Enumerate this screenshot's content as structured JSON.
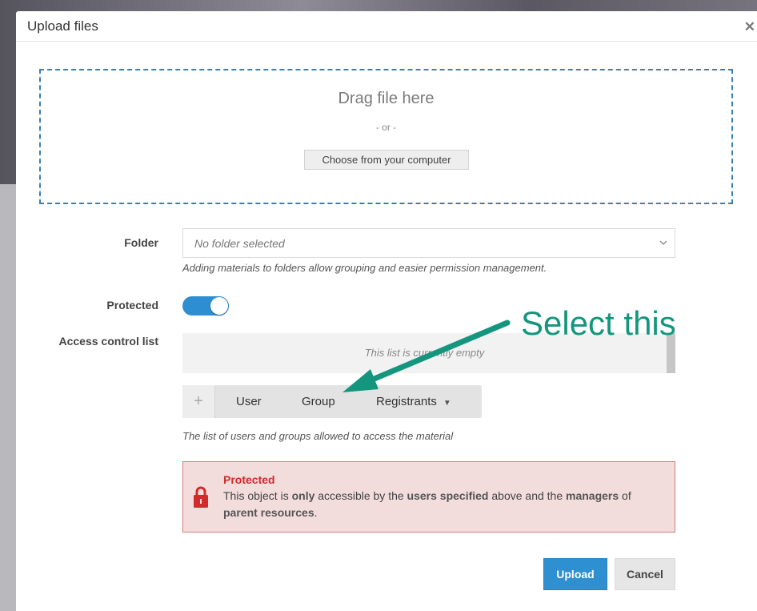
{
  "modal": {
    "title": "Upload files",
    "close_icon": "close-icon"
  },
  "dropzone": {
    "title": "Drag file here",
    "or_text": "- or -",
    "choose_button": "Choose from your computer"
  },
  "folder": {
    "label": "Folder",
    "selected_value": "No folder selected",
    "help": "Adding materials to folders allow grouping and easier permission management."
  },
  "protected": {
    "label": "Protected",
    "toggle_on": true
  },
  "acl": {
    "label": "Access control list",
    "empty_text": "This list is currently empty",
    "toolbar": {
      "add_icon": "plus-icon",
      "user": "User",
      "group": "Group",
      "registrants": "Registrants"
    },
    "help": "The list of users and groups allowed to access the material"
  },
  "alert": {
    "title": "Protected",
    "body_parts": {
      "p1": "This object is ",
      "b1": "only",
      "p2": " accessible by the ",
      "b2": "users specified",
      "p3": " above and the ",
      "b3": "managers",
      "p4": " of ",
      "b4": "parent resources",
      "p5": "."
    },
    "icon": "lock-icon",
    "colors": {
      "title": "#d22a2a",
      "background": "#f2dcdc",
      "border": "#d77c7c"
    }
  },
  "footer": {
    "upload": "Upload",
    "cancel": "Cancel"
  },
  "annotation": {
    "text": "Select this",
    "color": "#14967e"
  },
  "colors": {
    "accent": "#2e8fd1",
    "dropzone_border": "#3b7fb5"
  }
}
